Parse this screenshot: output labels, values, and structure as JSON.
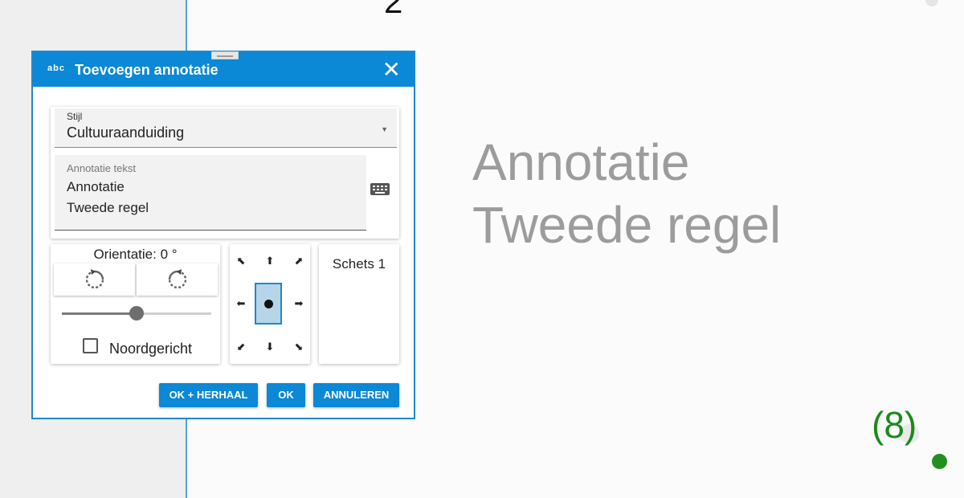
{
  "canvas": {
    "top_glyph": "2",
    "annotation_preview": {
      "line1": "Annotatie",
      "line2": "Tweede regel"
    },
    "counter": "(8)",
    "colors": {
      "preview_text": "#9c9c9c",
      "counter": "#1b8a1b",
      "marker": "#1f8f1f"
    }
  },
  "dialog": {
    "icon_text": "abc",
    "title": "Toevoegen annotatie",
    "close_icon": "close-icon",
    "style_select": {
      "label": "Stijl",
      "value": "Cultuuraanduiding"
    },
    "text_field": {
      "label": "Annotatie tekst",
      "lines": [
        "Annotatie",
        "Tweede regel"
      ]
    },
    "keyboard_icon": "keyboard-icon",
    "orientation": {
      "label": "Orientatie: 0 °",
      "rotate_left_icon": "rotate-ccw-icon",
      "rotate_right_icon": "rotate-cw-icon",
      "slider_level": 0.5,
      "north_label": "Noordgericht",
      "north_checked": false
    },
    "position": {
      "arrows": {
        "nw": "⬉",
        "n": "⬆",
        "ne": "⬈",
        "w": "⬅",
        "e": "➡",
        "sw": "⬋",
        "s": "⬇",
        "se": "⬊"
      },
      "selected": "center"
    },
    "sketch": {
      "label": "Schets 1"
    },
    "buttons": {
      "ok_repeat": "OK + HERHAAL",
      "ok": "OK",
      "cancel": "ANNULEREN"
    },
    "colors": {
      "accent": "#0b88d6",
      "border": "#1e88d0"
    }
  }
}
